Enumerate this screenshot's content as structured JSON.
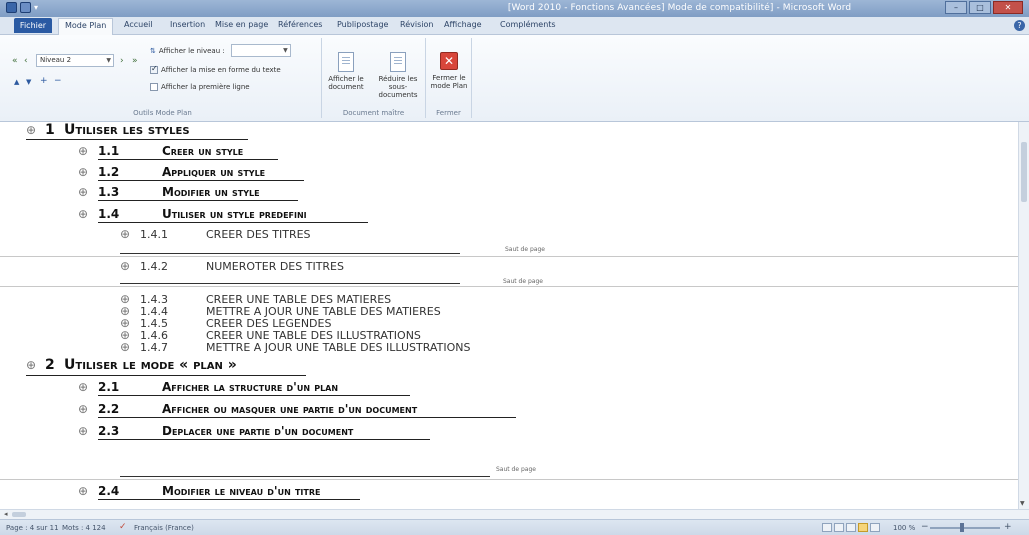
{
  "window": {
    "title": "[Word 2010 - Fonctions Avancées] Mode de compatibilité] - Microsoft Word",
    "controls": {
      "minimize": "–",
      "maximize": "□",
      "close": "✕"
    }
  },
  "qat": {
    "more": "▾"
  },
  "tabs": {
    "file": "Fichier",
    "items": [
      "Mode Plan",
      "Accueil",
      "Insertion",
      "Mise en page",
      "Références",
      "Publipostage",
      "Révision",
      "Affichage",
      "Compléments"
    ],
    "active_index": 0
  },
  "ribbon": {
    "outline_tools": {
      "label": "Outils Mode Plan",
      "level_dropdown": "Niveau 2",
      "show_level_dropdown": "Afficher le niveau :",
      "show_text_formatting": "Afficher la mise en forme du texte",
      "show_first_line_only": "Afficher la première ligne",
      "show_text_formatting_checked": true,
      "show_first_line_only_checked": false
    },
    "master_document": {
      "label": "Document maître",
      "show_document": "Afficher le document",
      "collapse_subdocuments": "Réduire les sous-documents"
    },
    "close": {
      "label": "Fermer",
      "close_outline": "Fermer le mode Plan"
    }
  },
  "outline": {
    "heading1": {
      "num": "1",
      "text": "Utiliser les styles"
    },
    "h1_1": {
      "num": "1.1",
      "text": "Creer un style"
    },
    "h1_2": {
      "num": "1.2",
      "text": "Appliquer un style"
    },
    "h1_3": {
      "num": "1.3",
      "text": "Modifier un style"
    },
    "h1_4": {
      "num": "1.4",
      "text": "Utiliser un style predefini"
    },
    "h1_4_1": {
      "num": "1.4.1",
      "text": "CREER DES TITRES"
    },
    "h1_4_2": {
      "num": "1.4.2",
      "text": "NUMEROTER DES TITRES"
    },
    "h1_4_3": {
      "num": "1.4.3",
      "text": "CREER UNE TABLE DES MATIERES"
    },
    "h1_4_4": {
      "num": "1.4.4",
      "text": "METTRE A JOUR UNE TABLE DES MATIERES"
    },
    "h1_4_5": {
      "num": "1.4.5",
      "text": "CREER DES LEGENDES"
    },
    "h1_4_6": {
      "num": "1.4.6",
      "text": "CREER UNE TABLE DES ILLUSTRATIONS"
    },
    "h1_4_7": {
      "num": "1.4.7",
      "text": "METTRE A JOUR UNE TABLE DES ILLUSTRATIONS"
    },
    "heading2": {
      "num": "2",
      "text": "Utiliser le mode « plan »"
    },
    "h2_1": {
      "num": "2.1",
      "text": "Afficher la structure d'un plan"
    },
    "h2_2": {
      "num": "2.2",
      "text": "Afficher ou masquer une partie d'un document"
    },
    "h2_3": {
      "num": "2.3",
      "text": "Deplacer une partie d'un document"
    },
    "h2_4": {
      "num": "2.4",
      "text": "Modifier le niveau d'un titre"
    },
    "page_break_label": "Saut de page"
  },
  "statusbar": {
    "page": "Page : 4 sur 11",
    "words": "Mots : 4 124",
    "language": "Français (France)",
    "zoom": "100 %",
    "zoom_minus": "−",
    "zoom_plus": "+"
  },
  "icons": {
    "bullet": "⊕",
    "promote_all": "«",
    "promote": "‹",
    "demote": "›",
    "demote_all": "»",
    "move_up": "▲",
    "move_down": "▼",
    "expand": "+",
    "collapse": "−",
    "close": "✕",
    "language_check": "✓"
  },
  "colors": {
    "file_tab": "#2a5aa3",
    "title_bar": "#7f9dc4",
    "close": "#d8463b"
  }
}
